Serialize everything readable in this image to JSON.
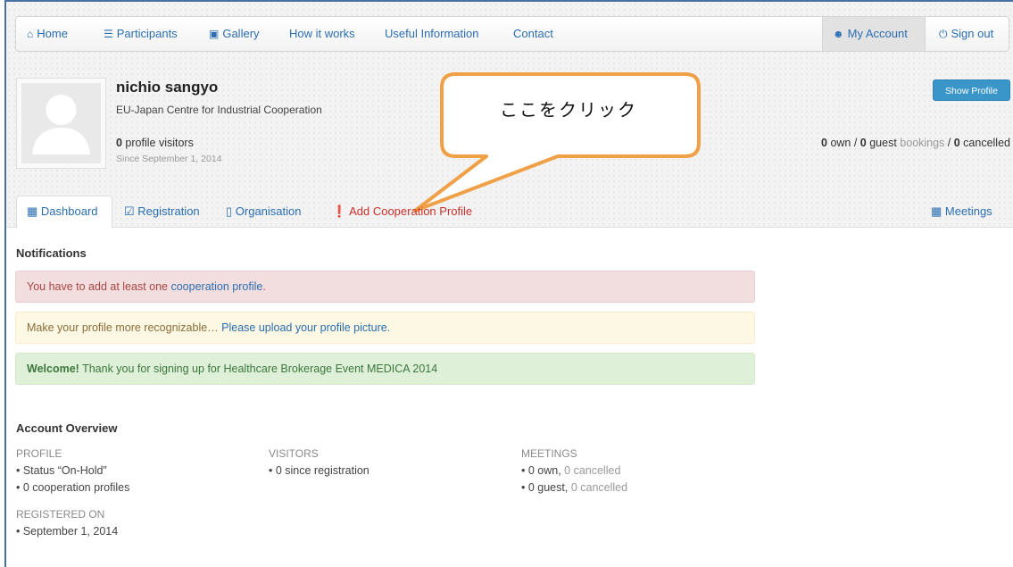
{
  "nav": {
    "items": [
      {
        "label": "Home",
        "icon": "home-icon",
        "glyph": "⌂"
      },
      {
        "label": "Participants",
        "icon": "list-icon",
        "glyph": "☰"
      },
      {
        "label": "Gallery",
        "icon": "picture-icon",
        "glyph": "▣"
      },
      {
        "label": "How it works"
      },
      {
        "label": "Useful Information"
      },
      {
        "label": "Contact"
      }
    ],
    "account_label": "My Account",
    "signout_label": "Sign out"
  },
  "profile": {
    "name": "nichio sangyo",
    "organisation": "EU-Japan Centre for Industrial Cooperation",
    "visitors_count": "0",
    "visitors_label": " profile visitors",
    "since": "Since September 1, 2014",
    "show_profile_label": "Show Profile",
    "bookings": {
      "own_count": "0",
      "own_label": " own / ",
      "guest_count": "0",
      "guest_label": " guest",
      "bookings_label": " bookings",
      "sep": " / ",
      "cancelled_count": "0",
      "cancelled_label": " cancelled"
    }
  },
  "callout": {
    "text": "ここをクリック"
  },
  "tabs": {
    "dashboard": "Dashboard",
    "registration": "Registration",
    "organisation": "Organisation",
    "add_profile": "Add Cooperation Profile",
    "meetings": "Meetings"
  },
  "notifications": {
    "title": "Notifications",
    "danger_prefix": "You have to add at least one ",
    "danger_link": "cooperation profile",
    "danger_suffix": ".",
    "warning_text": "Make your profile more recognizable… ",
    "warning_link": "Please upload your profile picture.",
    "success_bold": "Welcome!",
    "success_text": " Thank you for signing up for Healthcare Brokerage Event MEDICA 2014"
  },
  "overview": {
    "title": "Account Overview",
    "profile_head": "PROFILE",
    "profile_status": "• Status “On-Hold”",
    "profile_coop": "• 0 cooperation profiles",
    "visitors_head": "VISITORS",
    "visitors_line": "• 0 since registration",
    "meetings_head": "MEETINGS",
    "meetings_own": "• 0 own, ",
    "meetings_own_cancel": "0 cancelled",
    "meetings_guest": "• 0 guest, ",
    "meetings_guest_cancel": "0 cancelled",
    "registered_head": "REGISTERED ON",
    "registered_line": "• September 1, 2014"
  },
  "colors": {
    "link": "#2a6db0",
    "callout_stroke": "#f0a047",
    "danger": "#a94442",
    "success": "#3c763d",
    "warning": "#8a6d3b",
    "show_profile_bg": "#3a95c9"
  }
}
